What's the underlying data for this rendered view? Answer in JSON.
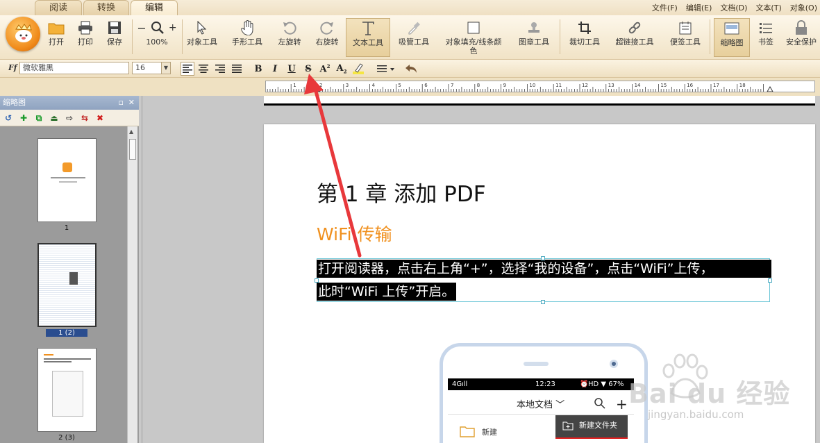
{
  "tabs": [
    "阅读",
    "转换",
    "编辑"
  ],
  "menu": [
    "文件(F)",
    "编辑(E)",
    "文档(D)",
    "文本(T)",
    "对象(O)"
  ],
  "toolbar": {
    "open": "打开",
    "print": "打印",
    "save": "保存",
    "zoom": "100%",
    "object_tool": "对象工具",
    "hand_tool": "手形工具",
    "rotate_left": "左旋转",
    "rotate_right": "右旋转",
    "text_tool": "文本工具",
    "eyedropper": "吸管工具",
    "fill_color_line1": "对象填充/线条颜",
    "fill_color_line2": "色",
    "stamp_tool": "图章工具",
    "crop_tool": "裁切工具",
    "hyperlink_tool": "超链接工具",
    "note_tool": "便签工具",
    "thumbnails": "缩略图",
    "bookmarks": "书签",
    "security": "安全保护"
  },
  "format": {
    "font_name": "微软雅黑",
    "font_size": "16"
  },
  "ruler_labels": [
    "1",
    "2",
    "3",
    "4",
    "5",
    "6",
    "7",
    "8",
    "9",
    "10",
    "11",
    "12",
    "13",
    "14",
    "15",
    "16",
    "17",
    "18"
  ],
  "panel": {
    "title": "缩略图",
    "thumbs": [
      {
        "label": "1"
      },
      {
        "label": "1 (2)"
      },
      {
        "label": "2 (3)"
      }
    ]
  },
  "document": {
    "chapter": "第 1 章 添加 PDF",
    "subhead": "WiFi 传输",
    "line1": "打开阅读器，点击右上角“+”，选择“我的设备”，点击“WiFi”上传，",
    "line2": "此时“WiFi 上传”开启。"
  },
  "phone": {
    "signal": "4G",
    "time": "12:23",
    "battery": "HD ▼ 67%",
    "title": "本地文档",
    "popup": "新建文件夹",
    "new_item": "新建"
  },
  "watermark": {
    "brand": "Bai du 经验",
    "url": "jingyan.baidu.com"
  },
  "colors": {
    "accent": "#f0901e",
    "highlight": "#000000",
    "arrow": "#e8383b"
  }
}
